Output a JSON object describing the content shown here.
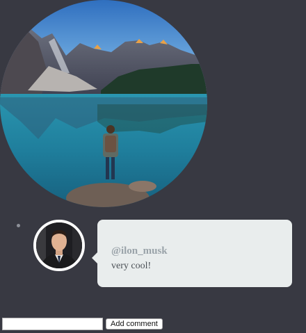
{
  "hero": {
    "image_subject": "mountain-lake-hiker-photo"
  },
  "comments": [
    {
      "username": "@ilon_musk",
      "text": "very cool!"
    }
  ],
  "add_comment": {
    "input_value": "",
    "button_label": "Add comment"
  },
  "colors": {
    "page_background": "#383942",
    "bubble_background": "#e9eded",
    "username_color": "#9aa3a9",
    "text_color": "#4a4f55"
  }
}
